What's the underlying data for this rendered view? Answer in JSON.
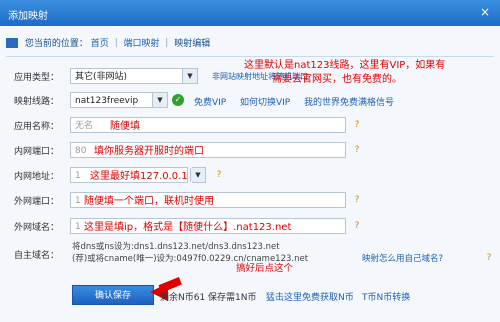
{
  "window": {
    "title": "添加映射",
    "close": "×"
  },
  "breadcrumb": {
    "prefix": "您当前的位置：",
    "home": "首页",
    "sep1": " ｜ ",
    "item1": "端口映射",
    "sep2": " ｜ ",
    "item2": "映射编辑"
  },
  "form": {
    "app_type": {
      "label": "应用类型：",
      "value": "其它(非网站)",
      "note": "非网站映射地址将随机端口"
    },
    "line": {
      "label": "映射线路：",
      "value": "nat123freevip",
      "vip": "免费VIP",
      "switch_vip": "如何切换VIP",
      "my_vip": "我的世界免费满格信号"
    },
    "app_name": {
      "label": "应用名称：",
      "placeholder": "无名",
      "annot": "随便填"
    },
    "lan_port": {
      "label": "内网端口：",
      "placeholder": "80",
      "annot": "填你服务器开服时的端口"
    },
    "lan_addr": {
      "label": "内网地址：",
      "placeholder": "1",
      "annot": "这里最好填127.0.0.1"
    },
    "wan_port": {
      "label": "外网端口：",
      "placeholder": "1",
      "annot": "随便填一个端口，联机时使用"
    },
    "wan_domain": {
      "label": "外网域名：",
      "placeholder": "1",
      "annot": "这里是填ip，格式是【随便什么】.nat123.net"
    },
    "self_domain": {
      "label": "自主域名：",
      "line1": "将dns或ns设为:dns1.dns123.net/dns3.dns123.net",
      "line2": "(荐)或将cname(唯一)设为:0497f0.0229.cn/cname123.net",
      "annot": "搞好后点这个",
      "link": "映射怎么用自己域名?"
    }
  },
  "top_annot": {
    "line1": "这里默认是nat123线路，这里有VIP，如果有",
    "line2": "需要去官网买，也有免费的。"
  },
  "bottom": {
    "confirm": "确认保存",
    "balance": "剩余N币61 保存需1N币",
    "get_free": "猛击这里免费获取N币",
    "convert": "T币N币转换"
  },
  "icons": {
    "help": "question-icon",
    "check": "check-icon",
    "home": "home-icon",
    "arrow": "red-arrow-annotation"
  }
}
